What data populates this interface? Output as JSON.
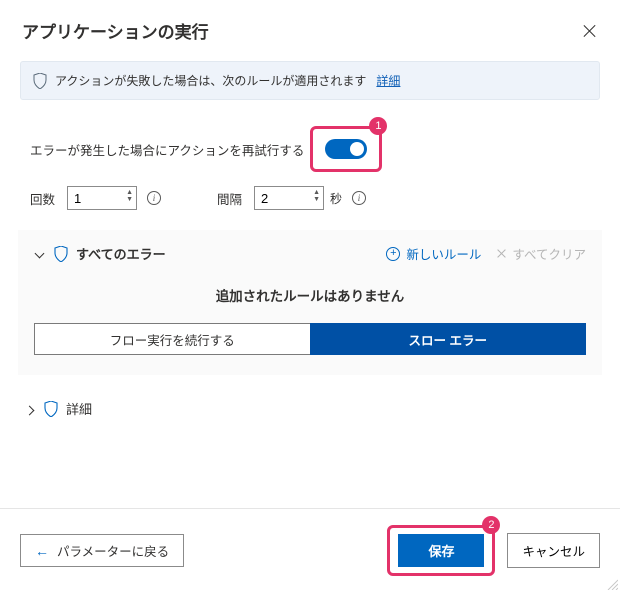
{
  "header": {
    "title": "アプリケーションの実行"
  },
  "info": {
    "text": "アクションが失敗した場合は、次のルールが適用されます",
    "link": "詳細"
  },
  "retry": {
    "label": "エラーが発生した場合にアクションを再試行する",
    "badge": "1"
  },
  "inputs": {
    "count_label": "回数",
    "count_value": "1",
    "interval_label": "間隔",
    "interval_value": "2",
    "seconds_suffix": "秒"
  },
  "all_errors": {
    "title": "すべてのエラー",
    "new_rule": "新しいルール",
    "clear_all": "すべてクリア",
    "empty": "追加されたルールはありません",
    "continue_flow": "フロー実行を続行する",
    "throw_error": "スロー エラー"
  },
  "detail_section": {
    "title": "詳細"
  },
  "footer": {
    "back": "パラメーターに戻る",
    "save": "保存",
    "cancel": "キャンセル",
    "save_badge": "2"
  }
}
